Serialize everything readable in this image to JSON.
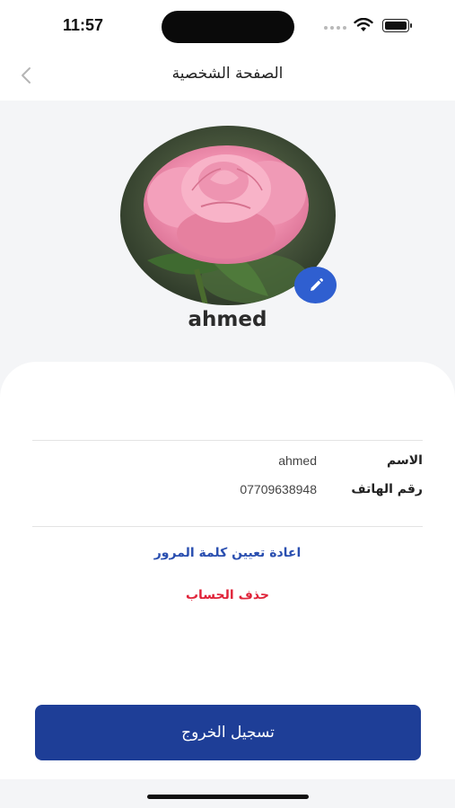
{
  "status_bar": {
    "time": "11:57"
  },
  "header": {
    "title": "الصفحة الشخصية",
    "back_icon": "chevron-left-icon"
  },
  "profile": {
    "username": "ahmed",
    "avatar": "pink-rose-photo",
    "edit_icon": "pencil-icon"
  },
  "details": {
    "name_label": "الاسم",
    "name_value": "ahmed",
    "phone_label": "رقم الهاتف",
    "phone_value": "07709638948"
  },
  "actions": {
    "reset_password": "اعادة تعيين كلمة المرور",
    "delete_account": "حذف الحساب",
    "logout": "تسجيل الخروج"
  },
  "colors": {
    "primary_button": "#1e3e97",
    "edit_button": "#2f5fd0",
    "link_blue": "#2a4fb0",
    "danger_red": "#e0243a"
  }
}
